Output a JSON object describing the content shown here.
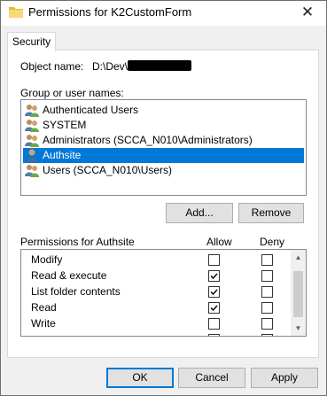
{
  "window": {
    "title": "Permissions for K2CustomForm",
    "close_glyph": "✕"
  },
  "tabs": [
    {
      "label": "Security"
    }
  ],
  "object": {
    "label": "Object name:",
    "value": "D:\\Dev\\K"
  },
  "group_label": "Group or user names:",
  "users": [
    {
      "name": "Authenticated Users",
      "icon": "group-icon",
      "selected": false
    },
    {
      "name": "SYSTEM",
      "icon": "group-icon",
      "selected": false
    },
    {
      "name": "Administrators (SCCA_N010\\Administrators)",
      "icon": "group-icon",
      "selected": false
    },
    {
      "name": "Authsite",
      "icon": "user-icon",
      "selected": true
    },
    {
      "name": "Users (SCCA_N010\\Users)",
      "icon": "group-icon",
      "selected": false
    }
  ],
  "buttons": {
    "add": "Add...",
    "remove": "Remove",
    "ok": "OK",
    "cancel": "Cancel",
    "apply": "Apply"
  },
  "permissions": {
    "header": "Permissions for Authsite",
    "allow_label": "Allow",
    "deny_label": "Deny",
    "rows": [
      {
        "name": "Modify",
        "allow": false,
        "deny": false
      },
      {
        "name": "Read & execute",
        "allow": true,
        "deny": false
      },
      {
        "name": "List folder contents",
        "allow": true,
        "deny": false
      },
      {
        "name": "Read",
        "allow": true,
        "deny": false
      },
      {
        "name": "Write",
        "allow": false,
        "deny": false
      }
    ]
  },
  "colors": {
    "selection": "#0078d7",
    "window_bg": "#f0f0f0",
    "folder": "#f8d775"
  }
}
